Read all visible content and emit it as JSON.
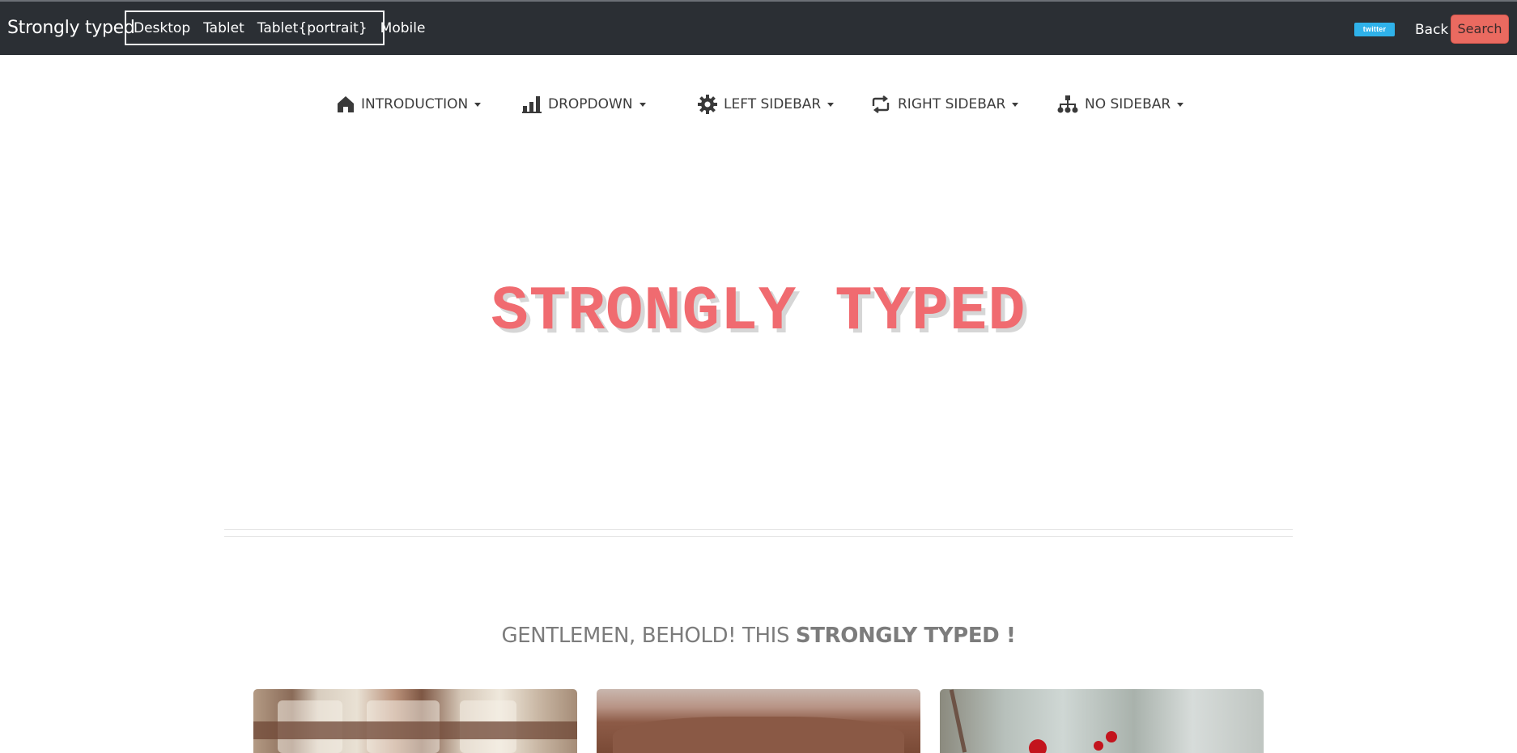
{
  "topbar": {
    "brand": "Strongly typed",
    "devices": [
      "Desktop",
      "Tablet",
      "Tablet{portrait}",
      "Mobile"
    ],
    "twitter_badge": "twitter",
    "back_label": "Back",
    "search_label": "Search"
  },
  "menu": [
    {
      "label": "INTRODUCTION",
      "icon": "home-icon"
    },
    {
      "label": "DROPDOWN",
      "icon": "bar-chart-icon"
    },
    {
      "label": "LEFT SIDEBAR",
      "icon": "gear-icon"
    },
    {
      "label": "RIGHT SIDEBAR",
      "icon": "retweet-icon"
    },
    {
      "label": "NO SIDEBAR",
      "icon": "sitemap-icon"
    }
  ],
  "hero": {
    "title": "STRONGLY TYPED"
  },
  "tagline": {
    "prefix": "GENTLEMEN, BEHOLD! THIS ",
    "emphasis": "STRONGLY TYPED !"
  },
  "colors": {
    "topbar_bg": "#2b2f34",
    "accent": "#f06b70",
    "search_button": "#ea6a60",
    "twitter": "#2fb2ea"
  }
}
